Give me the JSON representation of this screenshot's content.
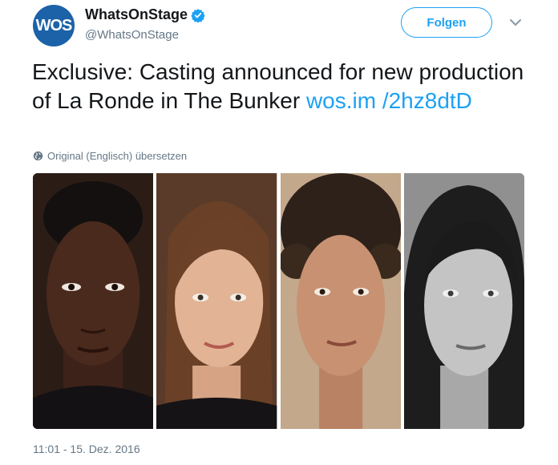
{
  "account": {
    "display_name": "WhatsOnStage",
    "handle": "@WhatsOnStage",
    "avatar_text": "WOS",
    "verified": true
  },
  "follow_label": "Folgen",
  "tweet": {
    "text": "Exclusive: Casting announced for new production of La Ronde in The Bunker ",
    "link": "wos.im /2hz8dtD"
  },
  "translate_label": "Original (Englisch) übersetzen",
  "photos": [
    {
      "name": "headshot-man-1"
    },
    {
      "name": "headshot-woman-1"
    },
    {
      "name": "headshot-woman-2"
    },
    {
      "name": "headshot-man-2"
    }
  ],
  "timestamp": "11:01 - 15. Dez. 2016",
  "colors": {
    "accent": "#1da1f2",
    "avatar_bg": "#1b62a8",
    "muted": "#657786"
  }
}
